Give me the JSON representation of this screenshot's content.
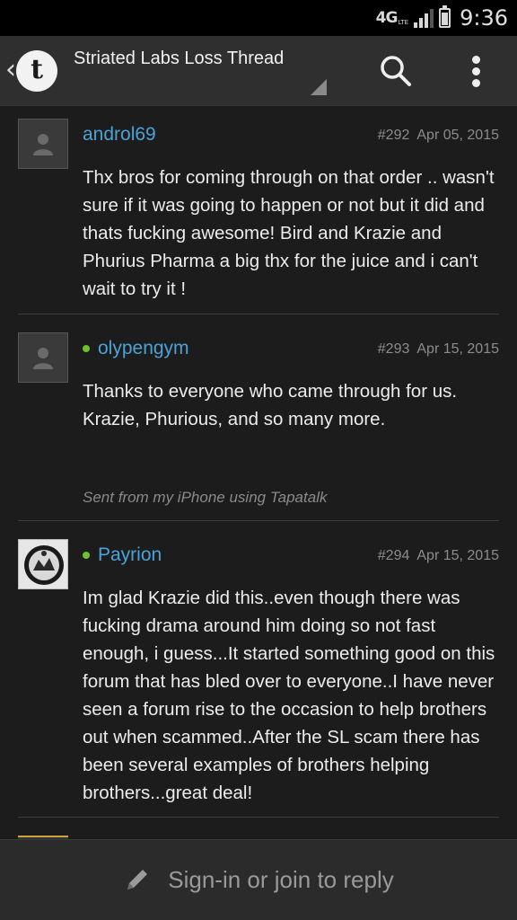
{
  "status_bar": {
    "network": "4G",
    "network_sub": "LTE",
    "time": "9:36"
  },
  "header": {
    "title": "Striated Labs Loss Thread"
  },
  "posts": [
    {
      "username": "androl69",
      "online": false,
      "number": "#292",
      "date": "Apr 05, 2015",
      "body": "Thx bros for coming through on that order .. wasn't sure if it was going to happen or not but it did and thats fucking awesome! Bird and Krazie and Phurius Pharma a big thx for the juice and i can't wait to try it !"
    },
    {
      "username": "olypengym",
      "online": true,
      "number": "#293",
      "date": "Apr 15, 2015",
      "body": "Thanks to everyone who came through for us. Krazie, Phurious, and so many more.",
      "signature": "Sent from my iPhone using Tapatalk"
    },
    {
      "username": "Payrion",
      "online": true,
      "number": "#294",
      "date": "Apr 15, 2015",
      "body": "Im glad Krazie did this..even though there was fucking drama around him doing so not fast enough, i guess...It started something good on this forum that has bled over to everyone..I have never seen a forum rise to the occasion to help brothers out when scammed..After the SL scam there has been several examples of brothers helping brothers...great deal!"
    }
  ],
  "reply": {
    "label": "Sign-in or join to reply"
  },
  "colors": {
    "username": "#4aa3d8",
    "online": "#6ec12b",
    "background": "#1c1c1c",
    "header": "#2f2f2f"
  },
  "icons": {
    "back": "chevron-left-icon",
    "logo": "tapatalk-logo-icon",
    "search": "search-icon",
    "menu": "more-vertical-icon",
    "compose": "pencil-icon"
  }
}
